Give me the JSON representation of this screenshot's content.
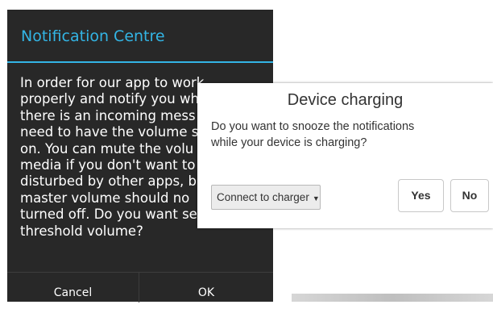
{
  "notification_dialog": {
    "title": "Notification Centre",
    "message_lines": [
      "In order for our app to work",
      "properly and notify you wh",
      "there is an incoming mess",
      "need to have the volume s",
      "on. You can mute the volu",
      "media if you don't want to",
      "disturbed by other apps, b",
      "master volume should no",
      "turned off. Do you want set now",
      "threshold volume?"
    ],
    "cancel_label": "Cancel",
    "ok_label": "OK",
    "accent_color": "#33b5e5",
    "background_color": "#282828"
  },
  "charging_dialog": {
    "title": "Device charging",
    "message_lines": [
      "Do you want to snooze the notifications",
      "while your device is charging?"
    ],
    "select_value": "Connect to charger",
    "yes_label": "Yes",
    "no_label": "No"
  }
}
